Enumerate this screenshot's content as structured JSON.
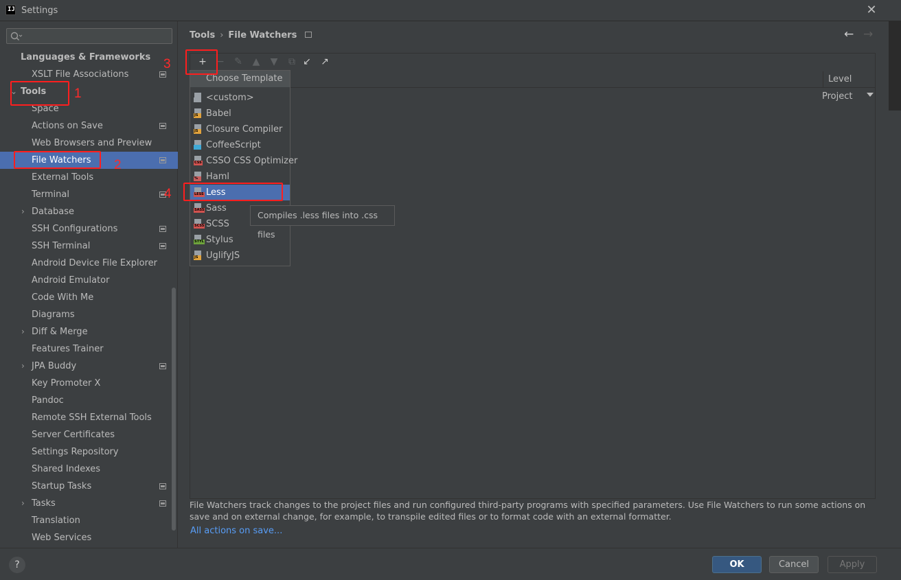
{
  "window": {
    "title": "Settings",
    "logo": "IJ"
  },
  "sidebar": {
    "search_placeholder": "",
    "items": [
      {
        "label": "Languages & Frameworks",
        "level": 0,
        "expandable": false,
        "selected": false,
        "project_icon": false,
        "name": "sidebar-item-languages-frameworks"
      },
      {
        "label": "XSLT File Associations",
        "level": 1,
        "expandable": false,
        "selected": false,
        "project_icon": true,
        "name": "sidebar-item-xslt-file-associations"
      },
      {
        "label": "Tools",
        "level": 0,
        "expandable": true,
        "selected": false,
        "project_icon": false,
        "name": "sidebar-item-tools"
      },
      {
        "label": "Space",
        "level": 1,
        "expandable": false,
        "selected": false,
        "project_icon": false,
        "name": "sidebar-item-space"
      },
      {
        "label": "Actions on Save",
        "level": 1,
        "expandable": false,
        "selected": false,
        "project_icon": true,
        "name": "sidebar-item-actions-on-save"
      },
      {
        "label": "Web Browsers and Preview",
        "level": 1,
        "expandable": false,
        "selected": false,
        "project_icon": false,
        "name": "sidebar-item-web-browsers"
      },
      {
        "label": "File Watchers",
        "level": 1,
        "expandable": false,
        "selected": true,
        "project_icon": true,
        "name": "sidebar-item-file-watchers"
      },
      {
        "label": "External Tools",
        "level": 1,
        "expandable": false,
        "selected": false,
        "project_icon": false,
        "name": "sidebar-item-external-tools"
      },
      {
        "label": "Terminal",
        "level": 1,
        "expandable": false,
        "selected": false,
        "project_icon": true,
        "name": "sidebar-item-terminal"
      },
      {
        "label": "Database",
        "level": 1,
        "expandable": true,
        "selected": false,
        "project_icon": false,
        "name": "sidebar-item-database"
      },
      {
        "label": "SSH Configurations",
        "level": 1,
        "expandable": false,
        "selected": false,
        "project_icon": true,
        "name": "sidebar-item-ssh-configurations"
      },
      {
        "label": "SSH Terminal",
        "level": 1,
        "expandable": false,
        "selected": false,
        "project_icon": true,
        "name": "sidebar-item-ssh-terminal"
      },
      {
        "label": "Android Device File Explorer",
        "level": 1,
        "expandable": false,
        "selected": false,
        "project_icon": false,
        "name": "sidebar-item-android-device-file-explorer"
      },
      {
        "label": "Android Emulator",
        "level": 1,
        "expandable": false,
        "selected": false,
        "project_icon": false,
        "name": "sidebar-item-android-emulator"
      },
      {
        "label": "Code With Me",
        "level": 1,
        "expandable": false,
        "selected": false,
        "project_icon": false,
        "name": "sidebar-item-code-with-me"
      },
      {
        "label": "Diagrams",
        "level": 1,
        "expandable": false,
        "selected": false,
        "project_icon": false,
        "name": "sidebar-item-diagrams"
      },
      {
        "label": "Diff & Merge",
        "level": 1,
        "expandable": true,
        "selected": false,
        "project_icon": false,
        "name": "sidebar-item-diff-merge"
      },
      {
        "label": "Features Trainer",
        "level": 1,
        "expandable": false,
        "selected": false,
        "project_icon": false,
        "name": "sidebar-item-features-trainer"
      },
      {
        "label": "JPA Buddy",
        "level": 1,
        "expandable": true,
        "selected": false,
        "project_icon": true,
        "name": "sidebar-item-jpa-buddy"
      },
      {
        "label": "Key Promoter X",
        "level": 1,
        "expandable": false,
        "selected": false,
        "project_icon": false,
        "name": "sidebar-item-key-promoter-x"
      },
      {
        "label": "Pandoc",
        "level": 1,
        "expandable": false,
        "selected": false,
        "project_icon": false,
        "name": "sidebar-item-pandoc"
      },
      {
        "label": "Remote SSH External Tools",
        "level": 1,
        "expandable": false,
        "selected": false,
        "project_icon": false,
        "name": "sidebar-item-remote-ssh-external-tools"
      },
      {
        "label": "Server Certificates",
        "level": 1,
        "expandable": false,
        "selected": false,
        "project_icon": false,
        "name": "sidebar-item-server-certificates"
      },
      {
        "label": "Settings Repository",
        "level": 1,
        "expandable": false,
        "selected": false,
        "project_icon": false,
        "name": "sidebar-item-settings-repository"
      },
      {
        "label": "Shared Indexes",
        "level": 1,
        "expandable": false,
        "selected": false,
        "project_icon": false,
        "name": "sidebar-item-shared-indexes"
      },
      {
        "label": "Startup Tasks",
        "level": 1,
        "expandable": false,
        "selected": false,
        "project_icon": true,
        "name": "sidebar-item-startup-tasks"
      },
      {
        "label": "Tasks",
        "level": 1,
        "expandable": true,
        "selected": false,
        "project_icon": true,
        "name": "sidebar-item-tasks"
      },
      {
        "label": "Translation",
        "level": 1,
        "expandable": false,
        "selected": false,
        "project_icon": false,
        "name": "sidebar-item-translation"
      },
      {
        "label": "Web Services",
        "level": 1,
        "expandable": false,
        "selected": false,
        "project_icon": false,
        "name": "sidebar-item-web-services"
      }
    ]
  },
  "breadcrumb": {
    "parent": "Tools",
    "separator": "›",
    "current": "File Watchers"
  },
  "toolbar": {
    "buttons": [
      {
        "name": "add-button",
        "glyph": "+",
        "enabled": true
      },
      {
        "name": "remove-button",
        "glyph": "−",
        "enabled": false
      },
      {
        "name": "edit-button",
        "glyph": "✎",
        "enabled": false
      },
      {
        "name": "move-up-button",
        "glyph": "▲",
        "enabled": false
      },
      {
        "name": "move-down-button",
        "glyph": "▼",
        "enabled": false
      },
      {
        "name": "copy-button",
        "glyph": "⧉",
        "enabled": false
      },
      {
        "name": "import-button",
        "glyph": "↙",
        "enabled": true
      },
      {
        "name": "export-button",
        "glyph": "↗",
        "enabled": true
      }
    ]
  },
  "table": {
    "level_header": "Level",
    "row_level": "Project"
  },
  "popup": {
    "title": "Choose Template",
    "items": [
      {
        "label": "<custom>",
        "icon": "custom-icon",
        "tag": "",
        "tag_color": "#9aa0a6",
        "selected": false
      },
      {
        "label": "Babel",
        "icon": "js-file-icon",
        "tag": "JS",
        "tag_color": "#e2a33c",
        "selected": false
      },
      {
        "label": "Closure Compiler",
        "icon": "js-file-icon",
        "tag": "JS",
        "tag_color": "#e2a33c",
        "selected": false
      },
      {
        "label": "CoffeeScript",
        "icon": "coffeescript-icon",
        "tag": "",
        "tag_color": "#3fa9d6",
        "selected": false
      },
      {
        "label": "CSSO CSS Optimizer",
        "icon": "css-file-icon",
        "tag": "CSS",
        "tag_color": "#d0524f",
        "selected": false
      },
      {
        "label": "Haml",
        "icon": "haml-file-icon",
        "tag": "%",
        "tag_color": "#c85c5c",
        "selected": false
      },
      {
        "label": "Less",
        "icon": "less-file-icon",
        "tag": "LESS",
        "tag_color": "#d0524f",
        "selected": true
      },
      {
        "label": "Sass",
        "icon": "sass-file-icon",
        "tag": "SASS",
        "tag_color": "#d0524f",
        "selected": false
      },
      {
        "label": "SCSS",
        "icon": "scss-file-icon",
        "tag": "SCSS",
        "tag_color": "#d0524f",
        "selected": false
      },
      {
        "label": "Stylus",
        "icon": "stylus-file-icon",
        "tag": "STYL",
        "tag_color": "#6ea33c",
        "selected": false
      },
      {
        "label": "UglifyJS",
        "icon": "js-file-icon",
        "tag": "JS",
        "tag_color": "#e2a33c",
        "selected": false
      }
    ]
  },
  "tooltip": "Compiles .less files into .css files",
  "description": "File Watchers track changes to the project files and run configured third-party programs with specified parameters. Use File Watchers to run some actions on save and on external change, for example, to transpile edited files or to format code with an external formatter.",
  "link": "All actions on save...",
  "annotations": {
    "n1": "1",
    "n2": "2",
    "n3": "3",
    "n4": "4",
    "color": "#ff1e1e"
  },
  "footer": {
    "help": "?",
    "ok": "OK",
    "cancel": "Cancel",
    "apply": "Apply"
  }
}
